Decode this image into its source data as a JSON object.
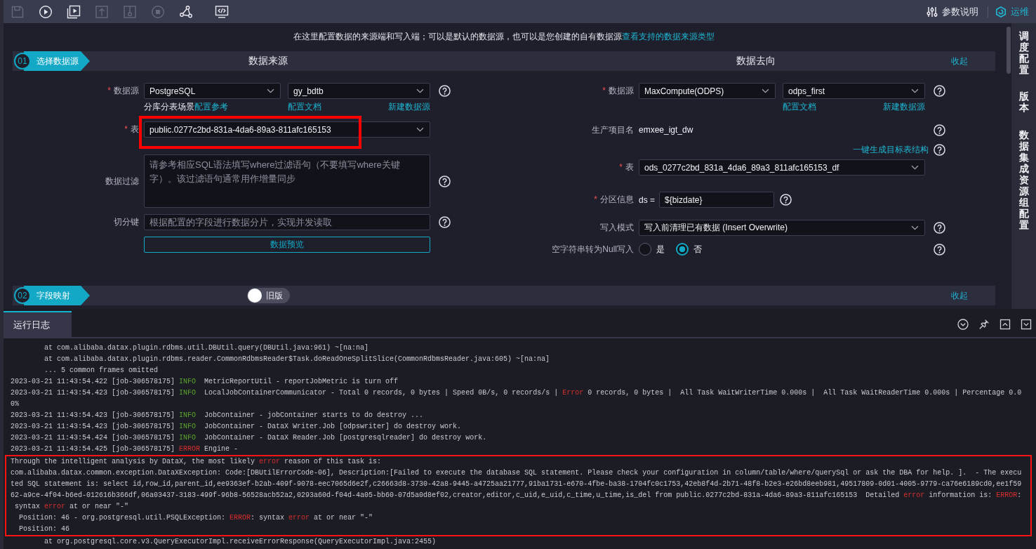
{
  "toolbar": {
    "tools": [
      {
        "kind": "save",
        "disabled": true
      },
      {
        "kind": "run",
        "disabled": false
      },
      {
        "kind": "run-params",
        "disabled": false
      },
      {
        "kind": "submit",
        "disabled": true
      },
      {
        "kind": "publish",
        "disabled": true
      },
      {
        "kind": "stop",
        "disabled": true
      },
      {
        "kind": "graph",
        "disabled": false
      },
      {
        "kind": "code",
        "disabled": false
      }
    ],
    "actions": [
      {
        "kind": "params",
        "label": "参数说明"
      },
      {
        "kind": "ops",
        "label": "运维"
      }
    ]
  },
  "intro": {
    "text": "在这里配置数据的来源端和写入端；可以是默认的数据源，也可以是您创建的自有数据源",
    "link": "查看支持的数据来源类型"
  },
  "sections": [
    {
      "number": "01",
      "title": "选择数据源",
      "source_title": "数据来源",
      "target_title": "数据去向",
      "collapse": "收起",
      "source": {
        "rows": [
          {
            "kind": "select-pair",
            "mark": "*",
            "label": "数据源",
            "values": [
              "PostgreSQL",
              "gy_bdtb"
            ],
            "help": true
          },
          {
            "kind": "links",
            "lead": [
              {
                "text": "分库分表场景",
                "link": false
              },
              {
                "text": "配置参考",
                "link": true
              }
            ],
            "left": "配置文档",
            "right": "新建数据源"
          },
          {
            "kind": "select",
            "mark": "*",
            "label": "表",
            "value": "public.0277c2bd-831a-4da6-89a3-811afc165153",
            "highlighted": true
          },
          {
            "kind": "textarea",
            "label": "数据过滤",
            "placeholder": "请参考相应SQL语法填写where过滤语句（不要填写where关键字）。该过滤语句通常用作增量同步",
            "help": true
          },
          {
            "kind": "input",
            "label": "切分键",
            "placeholder": "根据配置的字段进行数据分片，实现并发读取",
            "help": true
          },
          {
            "kind": "button",
            "label": "数据预览"
          }
        ]
      },
      "target": {
        "rows": [
          {
            "kind": "select-pair",
            "mark": "*",
            "label": "数据源",
            "values": [
              "MaxCompute(ODPS)",
              "odps_first"
            ],
            "help": true
          },
          {
            "kind": "links",
            "left": "配置文档",
            "right": "新建数据源"
          },
          {
            "kind": "text",
            "label": "生产项目名",
            "value": "emxee_igt_dw",
            "help": true
          },
          {
            "kind": "action",
            "link": "一键生成目标表结构",
            "help": true
          },
          {
            "kind": "select",
            "mark": "*",
            "label": "表",
            "value": "ods_0277c2bd_831a_4da6_89a3_811afc165153_df"
          },
          {
            "kind": "partition",
            "mark": "*",
            "label": "分区信息",
            "prefix": "ds =",
            "value": "${bizdate}",
            "help": true
          },
          {
            "kind": "select",
            "label": "写入模式",
            "value": "写入前清理已有数据 (Insert Overwrite)",
            "help": true
          },
          {
            "kind": "radio",
            "label": "空字符串转为Null写入",
            "options": [
              {
                "label": "是",
                "selected": false
              },
              {
                "label": "否",
                "selected": true
              }
            ],
            "help": true
          }
        ]
      }
    },
    {
      "number": "02",
      "title": "字段映射",
      "toggle": {
        "label": "旧版",
        "on": false
      },
      "collapse": "收起"
    }
  ],
  "sidebar": {
    "tabs": [
      {
        "label": "调度配置",
        "selected": false
      },
      {
        "label": "版本",
        "selected": false
      },
      {
        "label": "数据集成资源组配置",
        "selected": false
      }
    ]
  },
  "log": {
    "tabs": [
      {
        "label": "运行日志",
        "selected": true
      }
    ],
    "lines": [
      {
        "kind": "trace",
        "segments": [
          {
            "kind": "plain",
            "text": "at com.alibaba.datax.plugin.rdbms.util.DBUtil.query(DBUtil.java:961) ~[na:na]"
          }
        ]
      },
      {
        "kind": "trace",
        "segments": [
          {
            "kind": "plain",
            "text": "at com.alibaba.datax.plugin.rdbms.reader.CommonRdbmsReader$Task.doReadOneSplitSlice(CommonRdbmsReader.java:605) ~[na:na]"
          }
        ]
      },
      {
        "kind": "trace",
        "segments": [
          {
            "kind": "plain",
            "text": "... 5 common frames omitted"
          }
        ]
      },
      {
        "kind": "entry",
        "segments": [
          {
            "kind": "plain",
            "text": "2023-03-21 11:43:54.422 [job-306578175] "
          },
          {
            "kind": "info",
            "text": "INFO"
          },
          {
            "kind": "plain",
            "text": "  MetricReportUtil - reportJobMetric is turn off"
          }
        ]
      },
      {
        "kind": "entry",
        "segments": [
          {
            "kind": "plain",
            "text": "2023-03-21 11:43:54.423 [job-306578175] "
          },
          {
            "kind": "info",
            "text": "INFO"
          },
          {
            "kind": "plain",
            "text": "  LocalJobContainerCommunicator - Total 0 records, 0 bytes | Speed 0B/s, 0 records/s | "
          },
          {
            "kind": "error",
            "text": "Error"
          },
          {
            "kind": "plain",
            "text": " 0 records, 0 bytes |  All Task WaitWriterTime 0.000s |  All Task WaitReaderTime 0.000s | Percentage 0.00%"
          }
        ]
      },
      {
        "kind": "entry",
        "segments": [
          {
            "kind": "plain",
            "text": "2023-03-21 11:43:54.423 [job-306578175] "
          },
          {
            "kind": "info",
            "text": "INFO"
          },
          {
            "kind": "plain",
            "text": "  JobContainer - jobContainer starts to do destroy ..."
          }
        ]
      },
      {
        "kind": "entry",
        "segments": [
          {
            "kind": "plain",
            "text": "2023-03-21 11:43:54.423 [job-306578175] "
          },
          {
            "kind": "info",
            "text": "INFO"
          },
          {
            "kind": "plain",
            "text": "  JobContainer - DataX Writer.Job [odpswriter] do destroy work."
          }
        ]
      },
      {
        "kind": "entry",
        "segments": [
          {
            "kind": "plain",
            "text": "2023-03-21 11:43:54.424 [job-306578175] "
          },
          {
            "kind": "info",
            "text": "INFO"
          },
          {
            "kind": "plain",
            "text": "  JobContainer - DataX Reader.Job [postgresqlreader] do destroy work."
          }
        ]
      },
      {
        "kind": "entry",
        "segments": [
          {
            "kind": "plain",
            "text": "2023-03-21 11:43:54.425 [job-306578175] "
          },
          {
            "kind": "error",
            "text": "ERROR"
          },
          {
            "kind": "plain",
            "text": " Engine -"
          }
        ]
      }
    ],
    "analysis": {
      "highlighted": true,
      "lines": [
        {
          "kind": "entry",
          "segments": [
            {
              "kind": "plain",
              "text": "Through the intelligent analysis by DataX, the most likely "
            },
            {
              "kind": "error",
              "text": "error"
            },
            {
              "kind": "plain",
              "text": " reason of this task is:"
            }
          ]
        },
        {
          "kind": "entry",
          "segments": [
            {
              "kind": "plain",
              "text": "com.alibaba.datax.common.exception.DataXException: Code:[DBUtilErrorCode-06], Description:[Failed to execute the database SQL statement. Please check your configuration in column/table/where/querySql or ask the DBA for help. ].  - The executed SQL statement is: select id,row_id,parent_id,ee9363ef-b2ab-409f-9078-eec7065d6e2f,c26663d8-3730-42a8-9445-a4725aa21777,91ba1731-e670-4fbe-ba38-1704fc0c1753,42eb8f4d-2b71-48f8-b2e3-e26bd8eeb981,49517809-0d01-4005-9779-ca76e6189cd0,ee1f5962-a9ce-4f04-b6ed-012616b366df,06a03437-3183-499f-96b8-56528acb52a2,0293a60d-f04d-4a05-bb60-07d5a0d8ef02,creator,editor,c_uid,e_uid,c_time,u_time,is_del from public.0277c2bd-831a-4da6-89a3-811afc165153  Detailed "
            },
            {
              "kind": "error",
              "text": "error"
            },
            {
              "kind": "plain",
              "text": " information is: "
            },
            {
              "kind": "error",
              "text": "ERROR"
            },
            {
              "kind": "plain",
              "text": ":"
            }
          ]
        },
        {
          "kind": "wrap",
          "segments": [
            {
              "kind": "plain",
              "text": "syntax "
            },
            {
              "kind": "error",
              "text": "error"
            },
            {
              "kind": "plain",
              "text": " at or near \"-\""
            }
          ]
        },
        {
          "kind": "detail",
          "segments": [
            {
              "kind": "plain",
              "text": "Position: 46 - org.postgresql.util.PSQLException: "
            },
            {
              "kind": "error",
              "text": "ERROR"
            },
            {
              "kind": "plain",
              "text": ": syntax "
            },
            {
              "kind": "error",
              "text": "error"
            },
            {
              "kind": "plain",
              "text": " at or near \"-\""
            }
          ]
        },
        {
          "kind": "detail",
          "segments": [
            {
              "kind": "plain",
              "text": "Position: 46"
            }
          ]
        }
      ]
    },
    "tail": [
      {
        "kind": "trace",
        "segments": [
          {
            "kind": "plain",
            "text": "at org.postgresql.core.v3.QueryExecutorImpl.receiveErrorResponse(QueryExecutorImpl.java:2455)"
          }
        ]
      }
    ]
  }
}
